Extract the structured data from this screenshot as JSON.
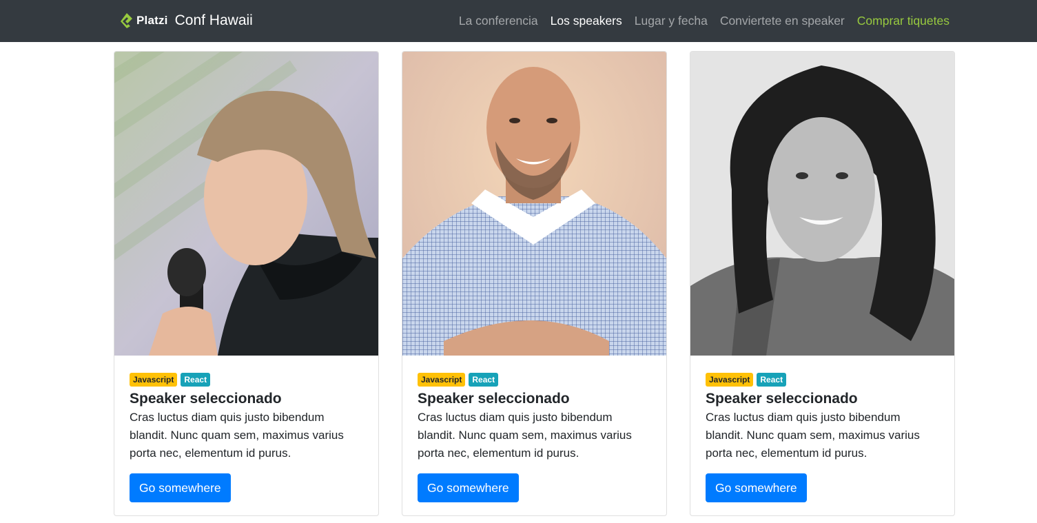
{
  "navbar": {
    "brand_platzi": "Platzi",
    "brand_conf": "Conf Hawaii",
    "links": [
      {
        "label": "La conferencia"
      },
      {
        "label": "Los speakers"
      },
      {
        "label": "Lugar y fecha"
      },
      {
        "label": "Conviertete en speaker"
      },
      {
        "label": "Comprar tiquetes"
      }
    ],
    "background": "#343a40",
    "accent": "#98ca3f"
  },
  "speakers": [
    {
      "badges": [
        "Javascript",
        "React"
      ],
      "title": "Speaker seleccionado",
      "text": "Cras luctus diam quis justo bibendum blandit. Nunc quam sem, maximus varius porta nec, elementum id purus.",
      "button": "Go somewhere"
    },
    {
      "badges": [
        "Javascript",
        "React"
      ],
      "title": "Speaker seleccionado",
      "text": "Cras luctus diam quis justo bibendum blandit. Nunc quam sem, maximus varius porta nec, elementum id purus.",
      "button": "Go somewhere"
    },
    {
      "badges": [
        "Javascript",
        "React"
      ],
      "title": "Speaker seleccionado",
      "text": "Cras luctus diam quis justo bibendum blandit. Nunc quam sem, maximus varius porta nec, elementum id purus.",
      "button": "Go somewhere"
    }
  ],
  "colors": {
    "badge_javascript": "#ffc107",
    "badge_react": "#17a2b8",
    "button": "#007bff"
  }
}
